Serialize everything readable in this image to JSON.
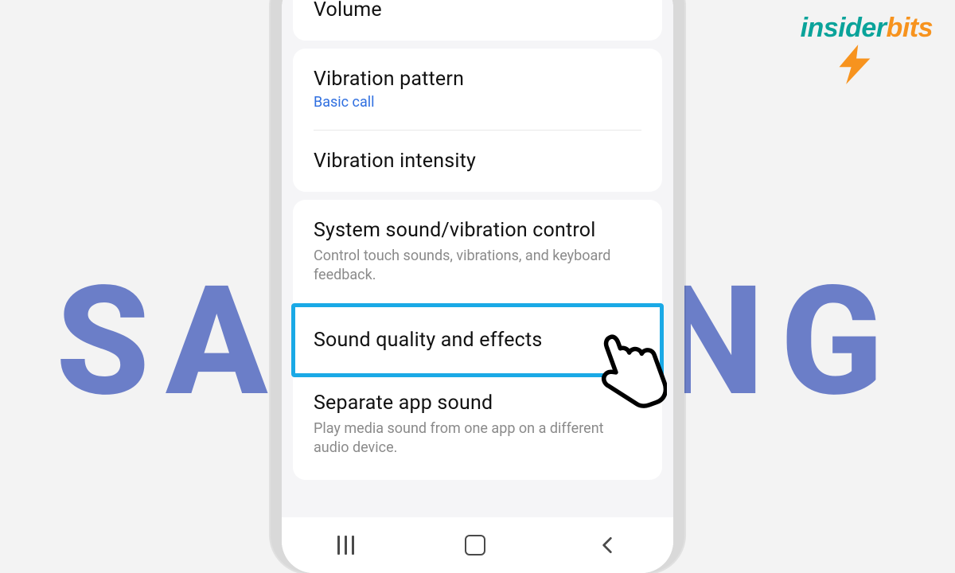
{
  "brand_text": "SAMSUNG",
  "logo": {
    "part1": "insider",
    "part2": "bits"
  },
  "highlight_color": "#1aa9e6",
  "groups": [
    {
      "items": [
        {
          "title": "Volume"
        }
      ]
    },
    {
      "items": [
        {
          "title": "Vibration pattern",
          "sub_blue": "Basic call",
          "divider_after": true
        },
        {
          "title": "Vibration intensity"
        }
      ]
    },
    {
      "items": [
        {
          "title": "System sound/vibration control",
          "sub": "Control touch sounds, vibrations, and keyboard feedback."
        },
        {
          "title": "Sound quality and effects",
          "highlighted": true,
          "pointer": true
        },
        {
          "title": "Separate app sound",
          "sub": "Play media sound from one app on a different audio device."
        }
      ]
    }
  ],
  "nav": {
    "recent": "recent",
    "home": "home",
    "back": "back"
  }
}
